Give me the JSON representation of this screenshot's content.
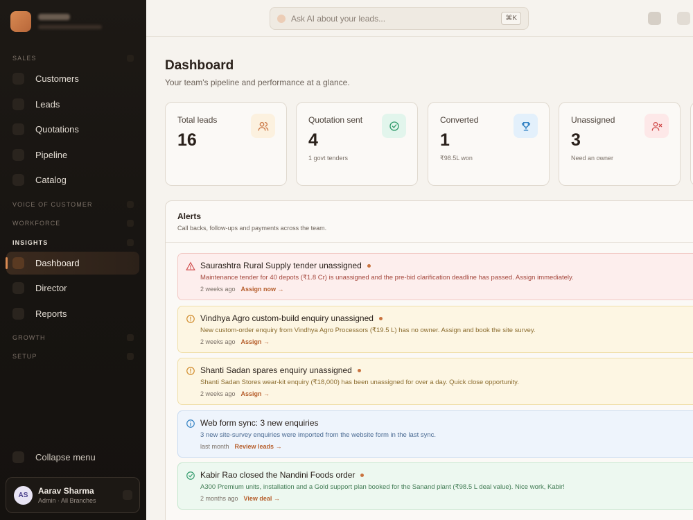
{
  "sidebar": {
    "sections": {
      "sales": "SALES",
      "voice": "VOICE OF CUSTOMER",
      "workforce": "WORKFORCE",
      "insights": "INSIGHTS",
      "growth": "GROWTH",
      "setup": "SETUP"
    },
    "items": {
      "customers": "Customers",
      "leads": "Leads",
      "quotations": "Quotations",
      "pipeline": "Pipeline",
      "catalog": "Catalog",
      "dashboard": "Dashboard",
      "director": "Director",
      "reports": "Reports"
    },
    "collapse": "Collapse menu",
    "user": {
      "initials": "AS",
      "name": "Aarav Sharma",
      "role": "Admin · All Branches"
    }
  },
  "topbar": {
    "search_placeholder": "Ask AI about your leads...",
    "shortcut": "⌘K"
  },
  "page": {
    "title": "Dashboard",
    "subtitle": "Your team's pipeline and performance at a glance."
  },
  "stats": [
    {
      "label": "Total leads",
      "value": "16",
      "sub": "",
      "icon": "users-icon",
      "color": "#c9723e",
      "bg": "#fcf1df"
    },
    {
      "label": "Quotation sent",
      "value": "4",
      "sub": "1 govt tenders",
      "icon": "check-circle-icon",
      "color": "#2f9a6a",
      "bg": "#e2f5ec"
    },
    {
      "label": "Converted",
      "value": "1",
      "sub": "₹98.5L won",
      "icon": "trophy-icon",
      "color": "#2e7fc2",
      "bg": "#e3f0fb"
    },
    {
      "label": "Unassigned",
      "value": "3",
      "sub": "Need an owner",
      "icon": "user-x-icon",
      "color": "#d04a4a",
      "bg": "#fde8e8"
    }
  ],
  "alerts": {
    "title": "Alerts",
    "subtitle": "Call backs, follow-ups and payments across the team.",
    "items": [
      {
        "title": "Saurashtra Rural Supply tender unassigned",
        "message": "Maintenance tender for 40 depots (₹1.8 Cr) is unassigned and the pre-bid clarification deadline has passed. Assign immediately.",
        "time": "2 weeks ago",
        "link": "Assign now →",
        "icon": "warning-triangle-icon"
      },
      {
        "title": "Vindhya Agro custom-build enquiry unassigned",
        "message": "New custom-order enquiry from Vindhya Agro Processors (₹19.5 L) has no owner. Assign and book the site survey.",
        "time": "2 weeks ago",
        "link": "Assign →",
        "icon": "alert-circle-icon"
      },
      {
        "title": "Shanti Sadan spares enquiry unassigned",
        "message": "Shanti Sadan Stores wear-kit enquiry (₹18,000) has been unassigned for over a day. Quick close opportunity.",
        "time": "2 weeks ago",
        "link": "Assign →",
        "icon": "alert-circle-icon"
      },
      {
        "title": "Web form sync: 3 new enquiries",
        "message": "3 new site-survey enquiries were imported from the website form in the last sync.",
        "time": "last month",
        "link": "Review leads →",
        "icon": "info-icon"
      },
      {
        "title": "Kabir Rao closed the Nandini Foods order",
        "message": "A300 Premium units, installation and a Gold support plan booked for the Sanand plant (₹98.5 L deal value). Nice work, Kabir!",
        "time": "2 months ago",
        "link": "View deal →",
        "icon": "check-circle-icon"
      }
    ]
  }
}
